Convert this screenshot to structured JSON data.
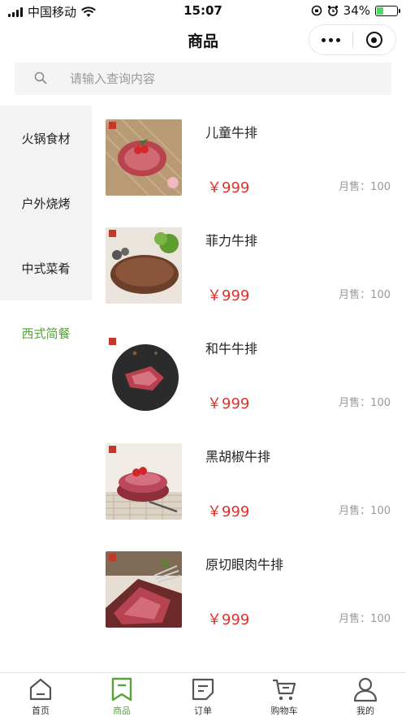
{
  "status_bar": {
    "carrier": "中国移动",
    "time": "15:07",
    "battery": "34%"
  },
  "nav": {
    "title": "商品"
  },
  "search": {
    "placeholder": "请输入查询内容"
  },
  "categories": [
    {
      "label": "火锅食材",
      "active": false
    },
    {
      "label": "户外烧烤",
      "active": false
    },
    {
      "label": "中式菜肴",
      "active": false
    },
    {
      "label": "西式简餐",
      "active": true
    }
  ],
  "products": [
    {
      "name": "儿童牛排",
      "price": "￥999",
      "sold": "月售：100"
    },
    {
      "name": "菲力牛排",
      "price": "￥999",
      "sold": "月售：100"
    },
    {
      "name": "和牛牛排",
      "price": "￥999",
      "sold": "月售：100"
    },
    {
      "name": "黑胡椒牛排",
      "price": "￥999",
      "sold": "月售：100"
    },
    {
      "name": "原切眼肉牛排",
      "price": "￥999",
      "sold": "月售：100"
    }
  ],
  "tabs": [
    {
      "label": "首页",
      "icon": "home-icon",
      "active": false
    },
    {
      "label": "商品",
      "icon": "bookmark-icon",
      "active": true
    },
    {
      "label": "订单",
      "icon": "order-icon",
      "active": false
    },
    {
      "label": "购物车",
      "icon": "cart-icon",
      "active": false
    },
    {
      "label": "我的",
      "icon": "user-icon",
      "active": false
    }
  ],
  "colors": {
    "accent": "#5aa13a",
    "price": "#e0312a"
  }
}
